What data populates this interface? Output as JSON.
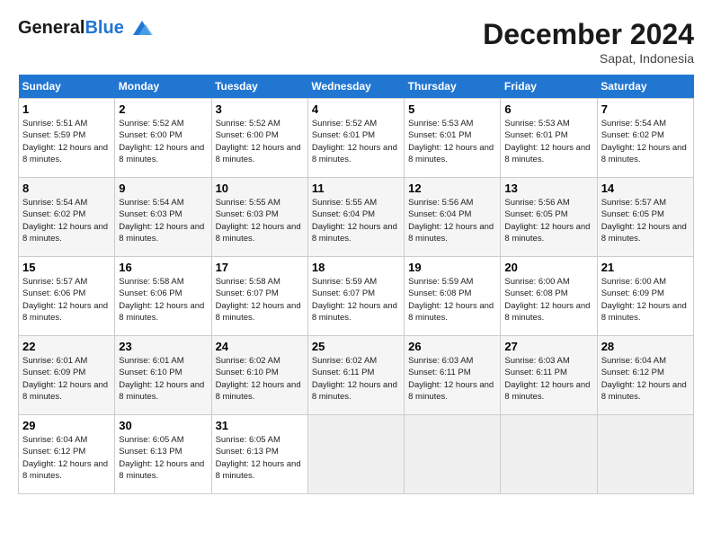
{
  "logo": {
    "line1": "General",
    "line2": "Blue"
  },
  "title": "December 2024",
  "location": "Sapat, Indonesia",
  "days_of_week": [
    "Sunday",
    "Monday",
    "Tuesday",
    "Wednesday",
    "Thursday",
    "Friday",
    "Saturday"
  ],
  "weeks": [
    [
      {
        "day": "1",
        "sunrise": "Sunrise: 5:51 AM",
        "sunset": "Sunset: 5:59 PM",
        "daylight": "Daylight: 12 hours and 8 minutes."
      },
      {
        "day": "2",
        "sunrise": "Sunrise: 5:52 AM",
        "sunset": "Sunset: 6:00 PM",
        "daylight": "Daylight: 12 hours and 8 minutes."
      },
      {
        "day": "3",
        "sunrise": "Sunrise: 5:52 AM",
        "sunset": "Sunset: 6:00 PM",
        "daylight": "Daylight: 12 hours and 8 minutes."
      },
      {
        "day": "4",
        "sunrise": "Sunrise: 5:52 AM",
        "sunset": "Sunset: 6:01 PM",
        "daylight": "Daylight: 12 hours and 8 minutes."
      },
      {
        "day": "5",
        "sunrise": "Sunrise: 5:53 AM",
        "sunset": "Sunset: 6:01 PM",
        "daylight": "Daylight: 12 hours and 8 minutes."
      },
      {
        "day": "6",
        "sunrise": "Sunrise: 5:53 AM",
        "sunset": "Sunset: 6:01 PM",
        "daylight": "Daylight: 12 hours and 8 minutes."
      },
      {
        "day": "7",
        "sunrise": "Sunrise: 5:54 AM",
        "sunset": "Sunset: 6:02 PM",
        "daylight": "Daylight: 12 hours and 8 minutes."
      }
    ],
    [
      {
        "day": "8",
        "sunrise": "Sunrise: 5:54 AM",
        "sunset": "Sunset: 6:02 PM",
        "daylight": "Daylight: 12 hours and 8 minutes."
      },
      {
        "day": "9",
        "sunrise": "Sunrise: 5:54 AM",
        "sunset": "Sunset: 6:03 PM",
        "daylight": "Daylight: 12 hours and 8 minutes."
      },
      {
        "day": "10",
        "sunrise": "Sunrise: 5:55 AM",
        "sunset": "Sunset: 6:03 PM",
        "daylight": "Daylight: 12 hours and 8 minutes."
      },
      {
        "day": "11",
        "sunrise": "Sunrise: 5:55 AM",
        "sunset": "Sunset: 6:04 PM",
        "daylight": "Daylight: 12 hours and 8 minutes."
      },
      {
        "day": "12",
        "sunrise": "Sunrise: 5:56 AM",
        "sunset": "Sunset: 6:04 PM",
        "daylight": "Daylight: 12 hours and 8 minutes."
      },
      {
        "day": "13",
        "sunrise": "Sunrise: 5:56 AM",
        "sunset": "Sunset: 6:05 PM",
        "daylight": "Daylight: 12 hours and 8 minutes."
      },
      {
        "day": "14",
        "sunrise": "Sunrise: 5:57 AM",
        "sunset": "Sunset: 6:05 PM",
        "daylight": "Daylight: 12 hours and 8 minutes."
      }
    ],
    [
      {
        "day": "15",
        "sunrise": "Sunrise: 5:57 AM",
        "sunset": "Sunset: 6:06 PM",
        "daylight": "Daylight: 12 hours and 8 minutes."
      },
      {
        "day": "16",
        "sunrise": "Sunrise: 5:58 AM",
        "sunset": "Sunset: 6:06 PM",
        "daylight": "Daylight: 12 hours and 8 minutes."
      },
      {
        "day": "17",
        "sunrise": "Sunrise: 5:58 AM",
        "sunset": "Sunset: 6:07 PM",
        "daylight": "Daylight: 12 hours and 8 minutes."
      },
      {
        "day": "18",
        "sunrise": "Sunrise: 5:59 AM",
        "sunset": "Sunset: 6:07 PM",
        "daylight": "Daylight: 12 hours and 8 minutes."
      },
      {
        "day": "19",
        "sunrise": "Sunrise: 5:59 AM",
        "sunset": "Sunset: 6:08 PM",
        "daylight": "Daylight: 12 hours and 8 minutes."
      },
      {
        "day": "20",
        "sunrise": "Sunrise: 6:00 AM",
        "sunset": "Sunset: 6:08 PM",
        "daylight": "Daylight: 12 hours and 8 minutes."
      },
      {
        "day": "21",
        "sunrise": "Sunrise: 6:00 AM",
        "sunset": "Sunset: 6:09 PM",
        "daylight": "Daylight: 12 hours and 8 minutes."
      }
    ],
    [
      {
        "day": "22",
        "sunrise": "Sunrise: 6:01 AM",
        "sunset": "Sunset: 6:09 PM",
        "daylight": "Daylight: 12 hours and 8 minutes."
      },
      {
        "day": "23",
        "sunrise": "Sunrise: 6:01 AM",
        "sunset": "Sunset: 6:10 PM",
        "daylight": "Daylight: 12 hours and 8 minutes."
      },
      {
        "day": "24",
        "sunrise": "Sunrise: 6:02 AM",
        "sunset": "Sunset: 6:10 PM",
        "daylight": "Daylight: 12 hours and 8 minutes."
      },
      {
        "day": "25",
        "sunrise": "Sunrise: 6:02 AM",
        "sunset": "Sunset: 6:11 PM",
        "daylight": "Daylight: 12 hours and 8 minutes."
      },
      {
        "day": "26",
        "sunrise": "Sunrise: 6:03 AM",
        "sunset": "Sunset: 6:11 PM",
        "daylight": "Daylight: 12 hours and 8 minutes."
      },
      {
        "day": "27",
        "sunrise": "Sunrise: 6:03 AM",
        "sunset": "Sunset: 6:11 PM",
        "daylight": "Daylight: 12 hours and 8 minutes."
      },
      {
        "day": "28",
        "sunrise": "Sunrise: 6:04 AM",
        "sunset": "Sunset: 6:12 PM",
        "daylight": "Daylight: 12 hours and 8 minutes."
      }
    ],
    [
      {
        "day": "29",
        "sunrise": "Sunrise: 6:04 AM",
        "sunset": "Sunset: 6:12 PM",
        "daylight": "Daylight: 12 hours and 8 minutes."
      },
      {
        "day": "30",
        "sunrise": "Sunrise: 6:05 AM",
        "sunset": "Sunset: 6:13 PM",
        "daylight": "Daylight: 12 hours and 8 minutes."
      },
      {
        "day": "31",
        "sunrise": "Sunrise: 6:05 AM",
        "sunset": "Sunset: 6:13 PM",
        "daylight": "Daylight: 12 hours and 8 minutes."
      },
      null,
      null,
      null,
      null
    ]
  ]
}
